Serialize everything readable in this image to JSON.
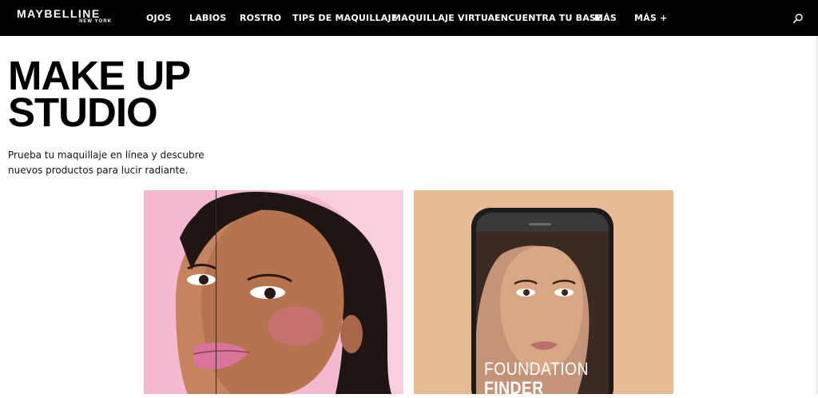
{
  "header": {
    "logo": {
      "brand": "MAYBELLINE",
      "city": "NEW YORK"
    },
    "nav": [
      "OJOS",
      "LABIOS",
      "ROSTRO",
      "TIPS DE MAQUILLAJE",
      "MAQUILLAJE VIRTUAL",
      "ENCUENTRA TU BASE",
      "MÁS",
      "MÁS +"
    ],
    "search_icon": "search-icon"
  },
  "main": {
    "title_line1": "MAKE UP",
    "title_line2": "STUDIO",
    "intro": "Prueba tu maquillaje en línea y descubre nuevos productos para lucir radiante.",
    "cards": [
      {
        "image": "virtual-try-on-portrait",
        "background": "#f4b8d1"
      },
      {
        "image": "phone-portrait",
        "background": "#e7bb96",
        "caption_line1": "FOUNDATION",
        "caption_line2": "FINDER"
      }
    ]
  },
  "colors": {
    "nav_bg": "#000000",
    "text": "#000000",
    "nav_text": "#ffffff"
  }
}
